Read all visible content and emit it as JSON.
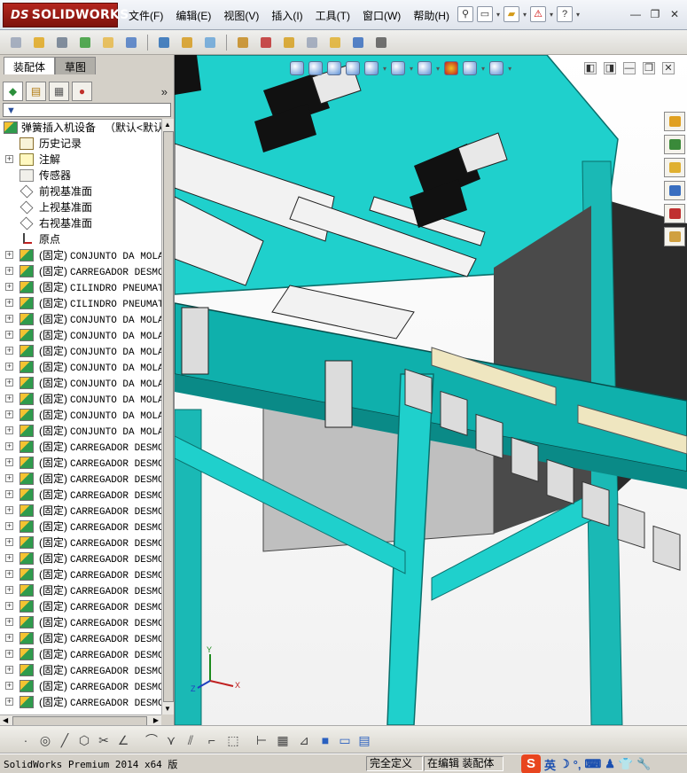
{
  "app": {
    "logo_ds": "DS",
    "logo_text": "SOLIDWORKS"
  },
  "menu": [
    "文件(F)",
    "编辑(E)",
    "视图(V)",
    "插入(I)",
    "工具(T)",
    "窗口(W)",
    "帮助(H)"
  ],
  "title_tools": [
    "new-document-icon",
    "open-folder-icon",
    "warning-icon",
    "help-icon"
  ],
  "window_controls": [
    "minimize-icon",
    "restore-icon",
    "close-icon"
  ],
  "panel_tabs": [
    "装配体",
    "草图"
  ],
  "feature_manager_tabs": [
    "feature-tree-icon",
    "property-manager-icon",
    "configuration-manager-icon",
    "display-manager-icon"
  ],
  "tree": {
    "root": {
      "label": "弹簧插入机设备",
      "config": "（默认<默认"
    },
    "fixed_items": [
      {
        "label": "历史记录",
        "icon": "history-icon"
      },
      {
        "label": "注解",
        "icon": "annotation-icon"
      },
      {
        "label": "传感器",
        "icon": "sensor-icon"
      },
      {
        "label": "前视基准面",
        "icon": "plane-icon"
      },
      {
        "label": "上视基准面",
        "icon": "plane-icon"
      },
      {
        "label": "右视基准面",
        "icon": "plane-icon"
      },
      {
        "label": "原点",
        "icon": "origin-icon"
      }
    ],
    "components": [
      {
        "state": "(固定)",
        "name": "CONJUNTO DA MOLA"
      },
      {
        "state": "(固定)",
        "name": "CARREGADOR DESMC"
      },
      {
        "state": "(固定)",
        "name": "CILINDRO PNEUMAT"
      },
      {
        "state": "(固定)",
        "name": "CILINDRO PNEUMAT"
      },
      {
        "state": "(固定)",
        "name": "CONJUNTO DA MOLA"
      },
      {
        "state": "(固定)",
        "name": "CONJUNTO DA MOLA"
      },
      {
        "state": "(固定)",
        "name": "CONJUNTO DA MOLA"
      },
      {
        "state": "(固定)",
        "name": "CONJUNTO DA MOLA"
      },
      {
        "state": "(固定)",
        "name": "CONJUNTO DA MOLA"
      },
      {
        "state": "(固定)",
        "name": "CONJUNTO DA MOLA"
      },
      {
        "state": "(固定)",
        "name": "CONJUNTO DA MOLA"
      },
      {
        "state": "(固定)",
        "name": "CONJUNTO DA MOLA"
      },
      {
        "state": "(固定)",
        "name": "CARREGADOR DESMC"
      },
      {
        "state": "(固定)",
        "name": "CARREGADOR DESMC"
      },
      {
        "state": "(固定)",
        "name": "CARREGADOR DESMC"
      },
      {
        "state": "(固定)",
        "name": "CARREGADOR DESMC"
      },
      {
        "state": "(固定)",
        "name": "CARREGADOR DESMC"
      },
      {
        "state": "(固定)",
        "name": "CARREGADOR DESMC"
      },
      {
        "state": "(固定)",
        "name": "CARREGADOR DESMC"
      },
      {
        "state": "(固定)",
        "name": "CARREGADOR DESMC"
      },
      {
        "state": "(固定)",
        "name": "CARREGADOR DESMC"
      },
      {
        "state": "(固定)",
        "name": "CARREGADOR DESMC"
      },
      {
        "state": "(固定)",
        "name": "CARREGADOR DESMC"
      },
      {
        "state": "(固定)",
        "name": "CARREGADOR DESMC"
      },
      {
        "state": "(固定)",
        "name": "CARREGADOR DESMC"
      },
      {
        "state": "(固定)",
        "name": "CARREGADOR DESMC"
      },
      {
        "state": "(固定)",
        "name": "CARREGADOR DESMC"
      },
      {
        "state": "(固定)",
        "name": "CARREGADOR DESMC"
      },
      {
        "state": "(固定)",
        "name": "CARREGADOR DESMC"
      }
    ]
  },
  "triad": {
    "x": "X",
    "y": "Y",
    "z": "Z"
  },
  "colors": {
    "machine_frame": "#1fd0cc",
    "frame_dark": "#0e8f8c",
    "cylinder": "#111111",
    "block": "#dcdcdc"
  },
  "status": {
    "app_version": "SolidWorks Premium 2014 x64 版",
    "definition": "完全定义",
    "mode": "在编辑 装配体"
  },
  "ime": {
    "lang": "英"
  }
}
